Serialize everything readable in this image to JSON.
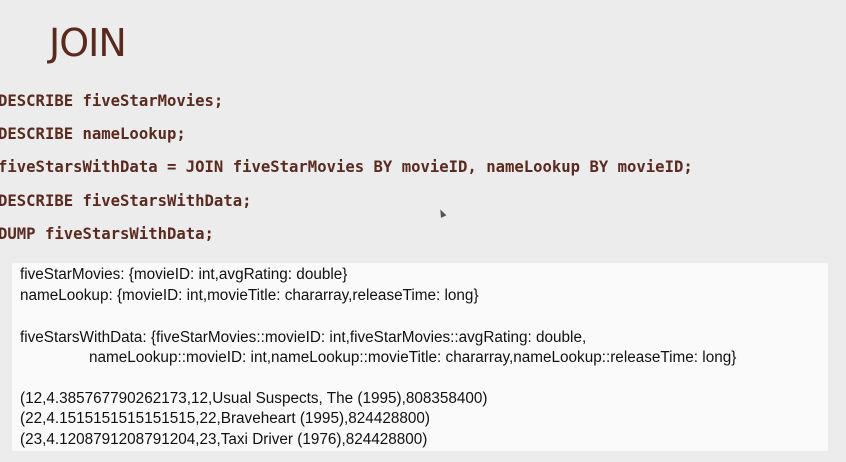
{
  "slide": {
    "title": "JOIN"
  },
  "code": [
    "DESCRIBE fiveStarMovies;",
    "DESCRIBE nameLookup;",
    "fiveStarsWithData = JOIN fiveStarMovies BY movieID, nameLookup BY movieID;",
    "DESCRIBE fiveStarsWithData;",
    "DUMP fiveStarsWithData;"
  ],
  "output": {
    "describe_five_star": "fiveStarMovies: {movieID: int,avgRating: double}",
    "describe_name_lookup": "nameLookup: {movieID: int,movieTitle: chararray,releaseTime: long}",
    "describe_joined_line1": "fiveStarsWithData: {fiveStarMovies::movieID: int,fiveStarMovies::avgRating: double,",
    "describe_joined_line2": "nameLookup::movieID: int,nameLookup::movieTitle: chararray,nameLookup::releaseTime: long}",
    "dump_rows": [
      "(12,4.385767790262173,12,Usual Suspects, The (1995),808358400)",
      "(22,4.1515151515151515,22,Braveheart (1995),824428800)",
      "(23,4.1208791208791204,23,Taxi Driver (1976),824428800)"
    ]
  }
}
